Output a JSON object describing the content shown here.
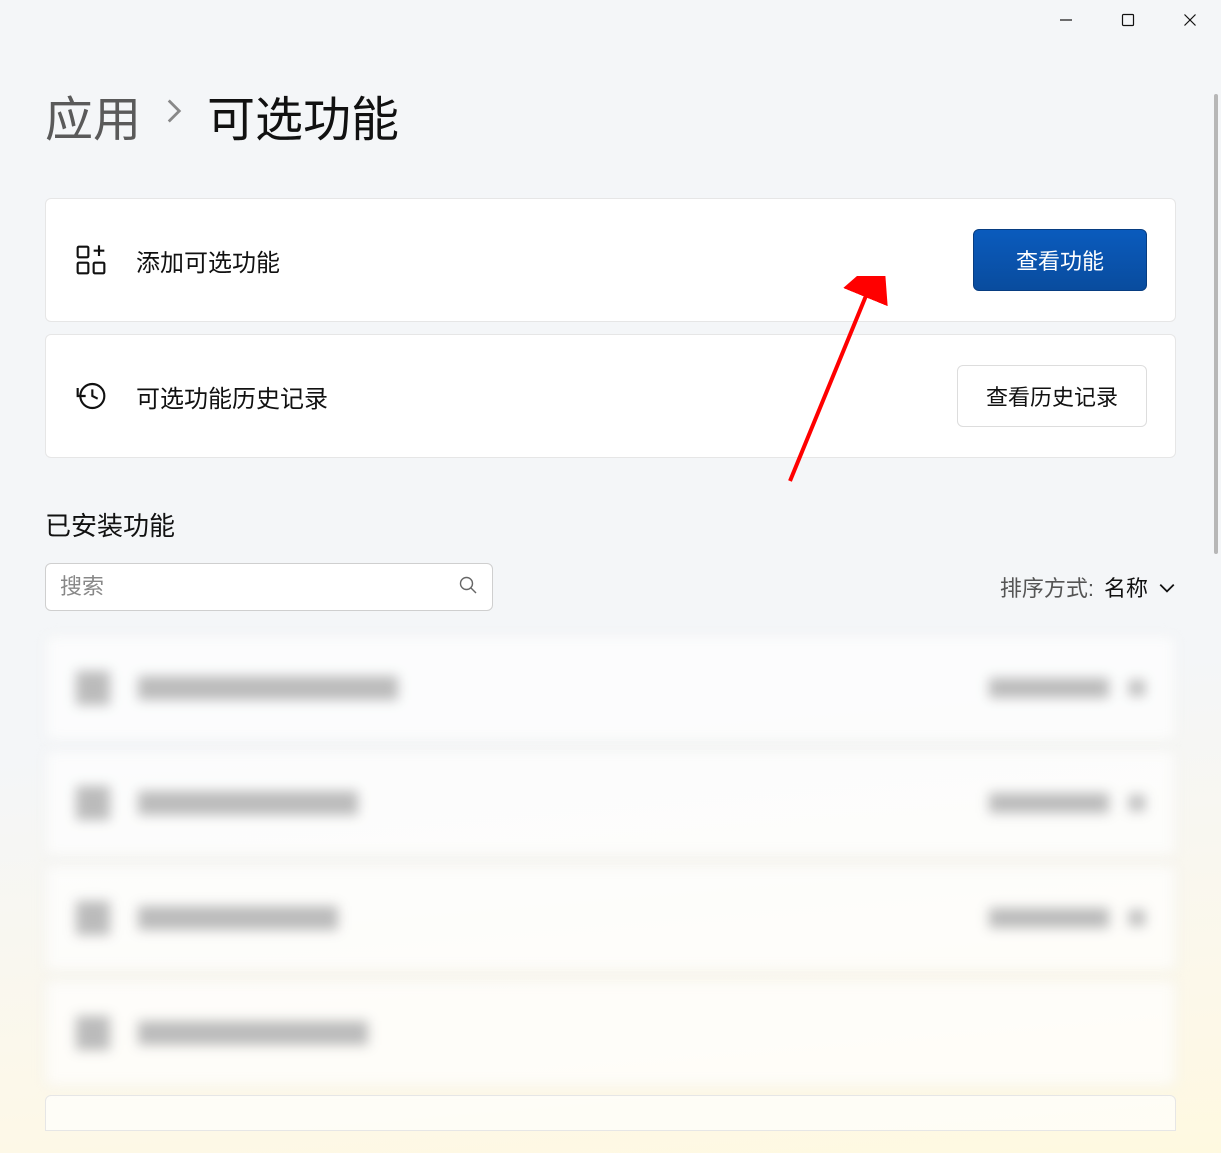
{
  "window_controls": {
    "minimize": "minimize",
    "maximize": "maximize",
    "close": "close"
  },
  "breadcrumb": {
    "root": "应用",
    "current": "可选功能"
  },
  "cards": {
    "add_feature_label": "添加可选功能",
    "add_feature_button": "查看功能",
    "history_label": "可选功能历史记录",
    "history_button": "查看历史记录"
  },
  "installed_section_title": "已安装功能",
  "search": {
    "placeholder": "搜索"
  },
  "sort": {
    "label": "排序方式:",
    "value": "名称"
  }
}
